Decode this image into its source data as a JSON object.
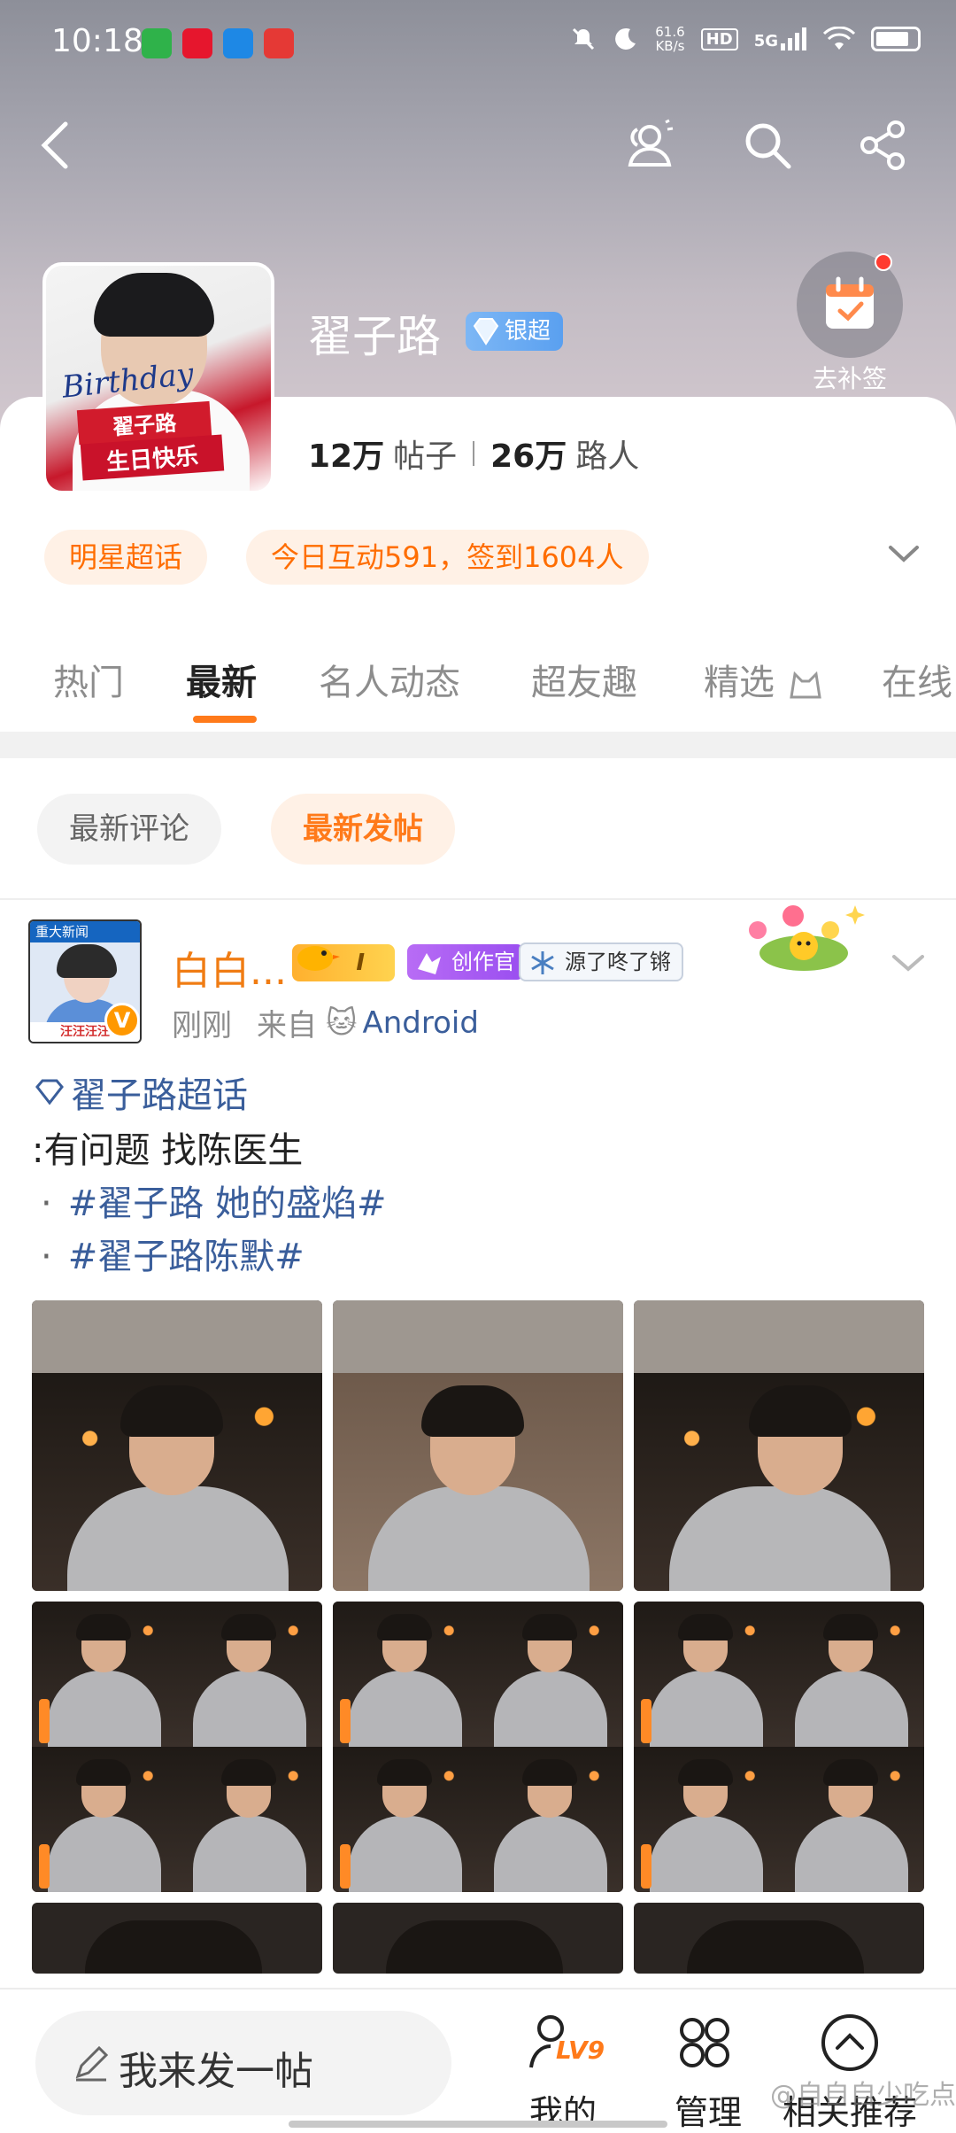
{
  "status_bar": {
    "time": "10:18",
    "network_speed": "61.6",
    "network_unit": "KB/s",
    "hd": "HD",
    "signal": "5G"
  },
  "topic": {
    "title": "翟子路",
    "badge": "银超",
    "checkin_label": "去补签",
    "avatar_text1": "翟子路",
    "avatar_text2": "生日快乐",
    "avatar_script": "Birthday",
    "posts_count": "12万",
    "posts_label": "帖子",
    "visitors_count": "26万",
    "visitors_label": "路人"
  },
  "chips": {
    "category": "明星超话",
    "activity": "今日互动591，签到1604人"
  },
  "tabs": [
    {
      "label": "热门"
    },
    {
      "label": "最新"
    },
    {
      "label": "名人动态"
    },
    {
      "label": "超友趣"
    },
    {
      "label": "精选"
    },
    {
      "label": "在线"
    }
  ],
  "filters": {
    "latest_comment": "最新评论",
    "latest_post": "最新发帖"
  },
  "post": {
    "avatar_top": "重大新闻",
    "avatar_bottom": "汪汪汪汪",
    "username": "白白...",
    "level": "I",
    "creator_badge": "创作官",
    "fan_badge": "源了咚了锵",
    "time": "刚刚",
    "source_prefix": "来自",
    "device": "Android",
    "topic_tag": "翟子路超话",
    "line1": ":有问题 找陈医生",
    "hashtag1": "#翟子路 她的盛焰#",
    "hashtag2": "#翟子路陈默#",
    "bullet": "·"
  },
  "bottom_bar": {
    "compose_placeholder": "我来发一帖",
    "mine": "我的",
    "level_badge": "LV9",
    "manage": "管理",
    "recommend": "相关推荐",
    "watermark": "@自自自少吃点"
  },
  "colors": {
    "accent": "#ff7a1a",
    "link": "#3a5e9b",
    "chip_bg": "#fff1e6"
  }
}
